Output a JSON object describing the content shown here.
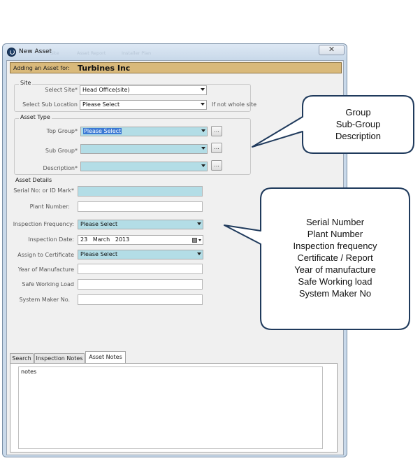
{
  "window": {
    "title": "New Asset",
    "ghost_menu": [
      "Site",
      "Asset Report",
      "Installer Plan"
    ],
    "close_glyph": "✕"
  },
  "header": {
    "label": "Adding an Asset for:",
    "value": "Turbines Inc"
  },
  "site": {
    "legend": "Site",
    "select_site_label": "Select Site*",
    "select_site_value": "Head Office(site)",
    "sub_location_label": "Select Sub Location",
    "sub_location_value": "Please Select",
    "sub_location_hint": "If not whole site"
  },
  "asset_type": {
    "legend": "Asset Type",
    "top_group_label": "Top Group*",
    "top_group_value": "Please Select",
    "sub_group_label": "Sub Group*",
    "sub_group_value": "",
    "description_label": "Description*",
    "description_value": "",
    "ellipsis": "..."
  },
  "asset_details": {
    "legend": "Asset Details",
    "serial_label": "Serial No: or ID Mark*",
    "plant_label": "Plant Number:",
    "frequency_label": "Inspection Frequency:",
    "frequency_value": "Please Select",
    "date_label": "Inspection Date:",
    "date_day": "23",
    "date_month": "March",
    "date_year": "2013",
    "certificate_label": "Assign to Certificate",
    "certificate_value": "Please Select",
    "year_label": "Year of Manufacture",
    "swl_label": "Safe Working Load",
    "maker_label": "System Maker No."
  },
  "tabs": [
    {
      "label": "Search"
    },
    {
      "label": "Inspection Notes"
    },
    {
      "label": "Asset Notes"
    }
  ],
  "notes": {
    "text": "notes"
  },
  "callout_1": {
    "lines": [
      "Group",
      "Sub-Group",
      "Description"
    ]
  },
  "callout_2": {
    "lines": [
      "Serial Number",
      "Plant Number",
      "Inspection frequency",
      "Certificate / Report",
      "Year of manufacture",
      "Safe Working load",
      "System Maker No"
    ]
  }
}
